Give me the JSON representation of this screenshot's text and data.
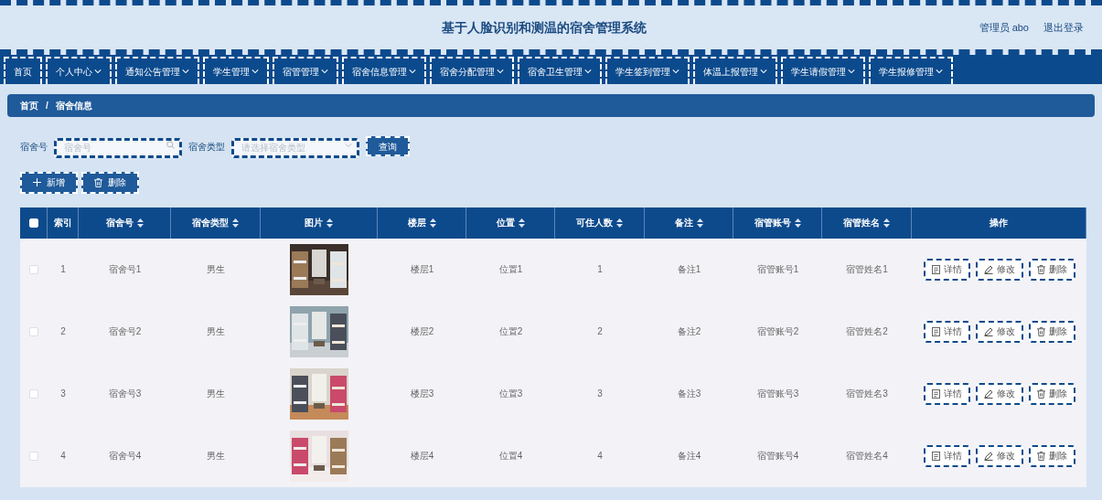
{
  "header": {
    "title": "基于人脸识别和测温的宿舍管理系统",
    "user": "管理员 abo",
    "logout": "退出登录"
  },
  "nav": [
    {
      "label": "首页",
      "dropdown": false
    },
    {
      "label": "个人中心",
      "dropdown": true
    },
    {
      "label": "通知公告管理",
      "dropdown": true
    },
    {
      "label": "学生管理",
      "dropdown": true
    },
    {
      "label": "宿管管理",
      "dropdown": true
    },
    {
      "label": "宿舍信息管理",
      "dropdown": true
    },
    {
      "label": "宿舍分配管理",
      "dropdown": true
    },
    {
      "label": "宿舍卫生管理",
      "dropdown": true
    },
    {
      "label": "学生签到管理",
      "dropdown": true
    },
    {
      "label": "体温上报管理",
      "dropdown": true
    },
    {
      "label": "学生请假管理",
      "dropdown": true
    },
    {
      "label": "学生报修管理",
      "dropdown": true
    }
  ],
  "breadcrumb": {
    "items": [
      "首页",
      "宿舍信息"
    ],
    "separator": "/"
  },
  "search": {
    "fields": [
      {
        "label": "宿舍号",
        "placeholder": "宿舍号",
        "kind": "text"
      },
      {
        "label": "宿舍类型",
        "placeholder": "请选择宿舍类型",
        "kind": "select"
      }
    ],
    "button": "查询"
  },
  "actions": [
    {
      "label": "新增",
      "kind": "add"
    },
    {
      "label": "删除",
      "kind": "delete"
    }
  ],
  "table": {
    "select_all": {
      "checked": false
    },
    "columns": [
      {
        "label": "索引",
        "kind": "index",
        "sortable": false
      },
      {
        "label": "宿舍号",
        "kind": "text",
        "sortable": true
      },
      {
        "label": "宿舍类型",
        "kind": "text",
        "sortable": true
      },
      {
        "label": "图片",
        "kind": "picture",
        "sortable": true
      },
      {
        "label": "楼层",
        "kind": "text",
        "sortable": true
      },
      {
        "label": "位置",
        "kind": "text",
        "sortable": true
      },
      {
        "label": "可住人数",
        "kind": "text",
        "sortable": true
      },
      {
        "label": "备注",
        "kind": "text",
        "sortable": true
      },
      {
        "label": "宿管账号",
        "kind": "text",
        "sortable": true
      },
      {
        "label": "宿管姓名",
        "kind": "text",
        "sortable": true
      },
      {
        "label": "操作",
        "kind": "actions",
        "sortable": false
      }
    ],
    "rows": [
      {
        "checked": false,
        "cells": [
          "1",
          "宿舍号1",
          "男生",
          {
            "kind": "picture"
          },
          "楼层1",
          "位置1",
          "1",
          "备注1",
          "宿管账号1",
          "宿管姓名1"
        ],
        "actions": [
          {
            "label": "详情",
            "kind": "detail"
          },
          {
            "label": "修改",
            "kind": "edit"
          },
          {
            "label": "删除",
            "kind": "delete"
          }
        ]
      },
      {
        "checked": false,
        "cells": [
          "2",
          "宿舍号2",
          "男生",
          {
            "kind": "picture"
          },
          "楼层2",
          "位置2",
          "2",
          "备注2",
          "宿管账号2",
          "宿管姓名2"
        ],
        "actions": [
          {
            "label": "详情",
            "kind": "detail"
          },
          {
            "label": "修改",
            "kind": "edit"
          },
          {
            "label": "删除",
            "kind": "delete"
          }
        ]
      },
      {
        "checked": false,
        "cells": [
          "3",
          "宿舍号3",
          "男生",
          {
            "kind": "picture"
          },
          "楼层3",
          "位置3",
          "3",
          "备注3",
          "宿管账号3",
          "宿管姓名3"
        ],
        "actions": [
          {
            "label": "详情",
            "kind": "detail"
          },
          {
            "label": "修改",
            "kind": "edit"
          },
          {
            "label": "删除",
            "kind": "delete"
          }
        ]
      },
      {
        "checked": false,
        "cells": [
          "4",
          "宿舍号4",
          "男生",
          {
            "kind": "picture"
          },
          "楼层4",
          "位置4",
          "4",
          "备注4",
          "宿管账号4",
          "宿管姓名4"
        ],
        "actions": [
          {
            "label": "详情",
            "kind": "detail"
          },
          {
            "label": "修改",
            "kind": "edit"
          },
          {
            "label": "删除",
            "kind": "delete"
          }
        ]
      }
    ]
  }
}
